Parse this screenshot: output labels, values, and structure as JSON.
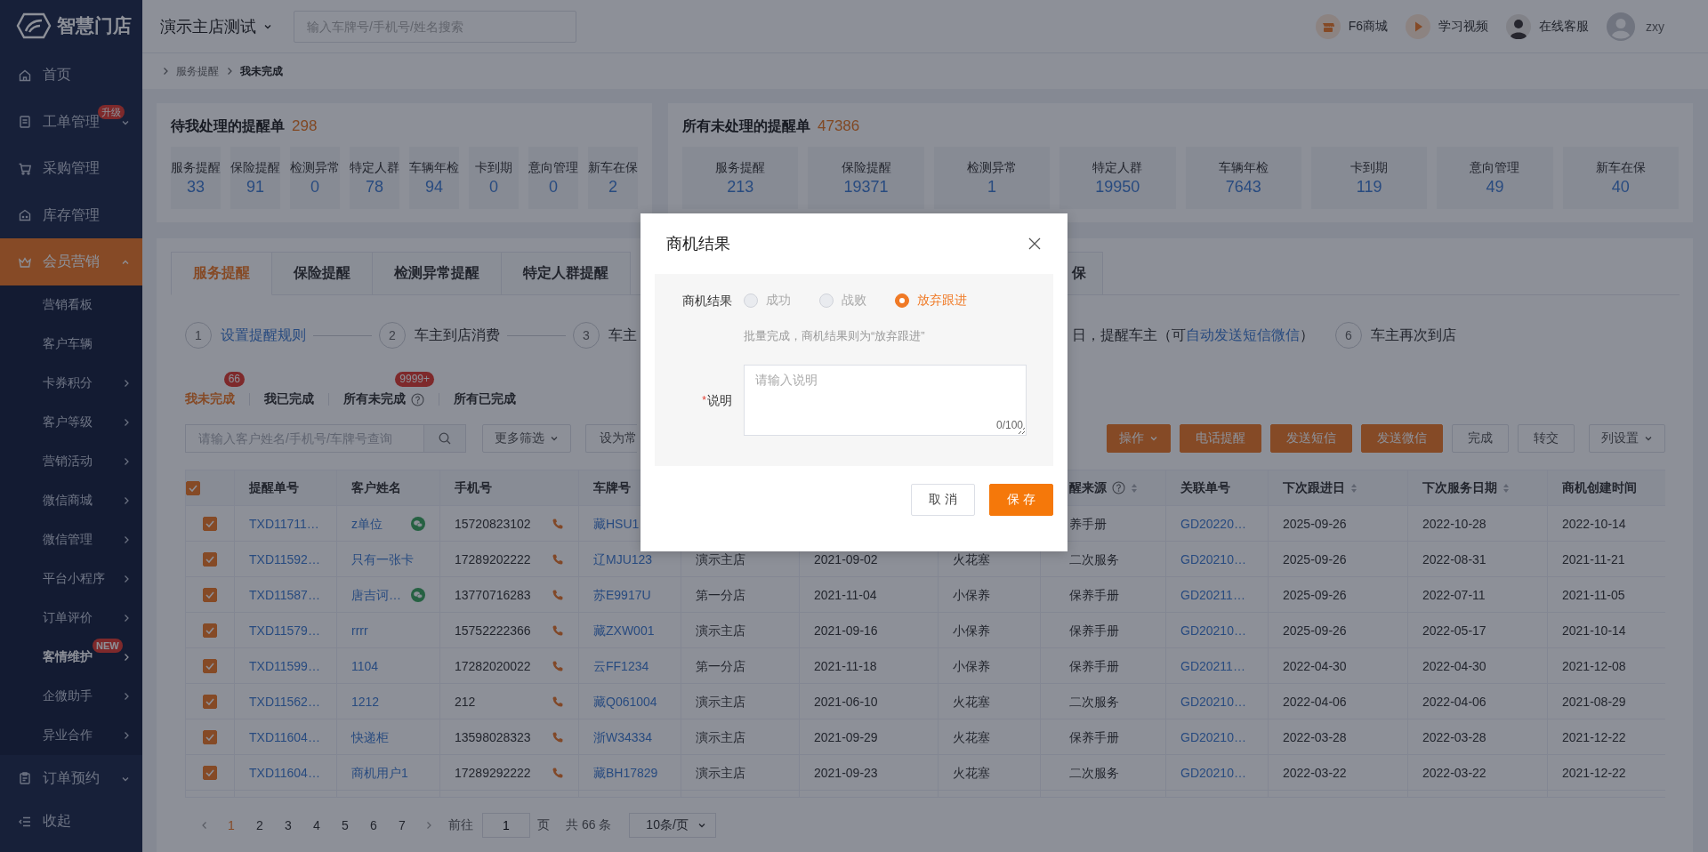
{
  "sidebar": {
    "logo": "智慧门店",
    "items": [
      {
        "kind": "link",
        "label": "首页",
        "selected": false
      },
      {
        "kind": "group",
        "label": "工单管理",
        "badge": "升级",
        "expanded": false,
        "selected": false
      },
      {
        "kind": "link",
        "label": "采购管理",
        "selected": false
      },
      {
        "kind": "link",
        "label": "库存管理",
        "selected": false
      },
      {
        "kind": "group",
        "label": "会员营销",
        "expanded": true,
        "selected": true,
        "children": [
          {
            "kind": "link",
            "label": "营销看板",
            "selected": false
          },
          {
            "kind": "link",
            "label": "客户车辆",
            "selected": false
          },
          {
            "kind": "menu",
            "label": "卡券积分",
            "selected": false
          },
          {
            "kind": "menu",
            "label": "客户等级",
            "selected": false
          },
          {
            "kind": "menu",
            "label": "营销活动",
            "selected": false
          },
          {
            "kind": "menu",
            "label": "微信商城",
            "selected": false
          },
          {
            "kind": "menu",
            "label": "微信管理",
            "selected": false
          },
          {
            "kind": "menu",
            "label": "平台小程序",
            "selected": false
          },
          {
            "kind": "menu",
            "label": "订单评价",
            "selected": false
          },
          {
            "kind": "menu",
            "label": "客情维护",
            "badge": "NEW",
            "selected": true
          },
          {
            "kind": "menu",
            "label": "企微助手",
            "selected": false
          },
          {
            "kind": "menu",
            "label": "异业合作",
            "selected": false
          }
        ]
      },
      {
        "kind": "group",
        "label": "订单预约",
        "expanded": false,
        "selected": false
      }
    ],
    "collapse": "收起"
  },
  "header": {
    "store": "演示主店测试",
    "search_placeholder": "输入车牌号/手机号/姓名搜索",
    "links": [
      {
        "label": "F6商城"
      },
      {
        "label": "学习视频"
      },
      {
        "label": "在线客服"
      }
    ],
    "user": "zxy"
  },
  "breadcrumb": [
    "服务提醒",
    "我未完成"
  ],
  "stats": [
    {
      "title": "待我处理的提醒单",
      "total": "298",
      "tiles": [
        {
          "label": "服务提醒",
          "value": "33"
        },
        {
          "label": "保险提醒",
          "value": "91"
        },
        {
          "label": "检测异常",
          "value": "0"
        },
        {
          "label": "特定人群",
          "value": "78"
        },
        {
          "label": "车辆年检",
          "value": "94"
        },
        {
          "label": "卡到期",
          "value": "0"
        },
        {
          "label": "意向管理",
          "value": "0"
        },
        {
          "label": "新车在保",
          "value": "2"
        }
      ]
    },
    {
      "title": "所有未处理的提醒单",
      "total": "47386",
      "tiles": [
        {
          "label": "服务提醒",
          "value": "213"
        },
        {
          "label": "保险提醒",
          "value": "19371"
        },
        {
          "label": "检测异常",
          "value": "1"
        },
        {
          "label": "特定人群",
          "value": "19950"
        },
        {
          "label": "车辆年检",
          "value": "7643"
        },
        {
          "label": "卡到期",
          "value": "119"
        },
        {
          "label": "意向管理",
          "value": "49"
        },
        {
          "label": "新车在保",
          "value": "40"
        }
      ]
    }
  ],
  "tabs": [
    {
      "label": "服务提醒",
      "selected": true
    },
    {
      "label": "保险提醒",
      "selected": false
    },
    {
      "label": "检测异常提醒",
      "selected": false
    },
    {
      "label": "特定人群提醒",
      "selected": false
    },
    {
      "label": "保",
      "selected": false
    }
  ],
  "steps": [
    {
      "kind": "link",
      "number": "1",
      "label": "设置提醒规则"
    },
    {
      "kind": "plain",
      "number": "2",
      "label": "车主到店消费"
    },
    {
      "kind": "plain",
      "number": "3",
      "label": "车主"
    },
    {
      "kind": "partial",
      "label": "日，提醒车主（可",
      "link": "自动发送短信微信",
      "after": "）"
    },
    {
      "kind": "plain",
      "number": "6",
      "label": "车主再次到店"
    }
  ],
  "filters": [
    {
      "label": "我未完成",
      "selected": true,
      "badge": "66"
    },
    {
      "label": "我已完成",
      "selected": false
    },
    {
      "label": "所有未完成",
      "selected": false,
      "badge": "9999+",
      "help": true
    },
    {
      "label": "所有已完成",
      "selected": false
    }
  ],
  "toolbar": {
    "search_placeholder": "请输入客户姓名/手机号/车牌号查询",
    "filters": [
      {
        "label": "更多筛选",
        "kind": "dropdown"
      },
      {
        "label": "设为常",
        "kind": "cut"
      }
    ],
    "actions": [
      {
        "label": "操作",
        "kind": "primary-dropdown"
      },
      {
        "label": "电话提醒",
        "kind": "primary"
      },
      {
        "label": "发送短信",
        "kind": "primary"
      },
      {
        "label": "发送微信",
        "kind": "primary"
      },
      {
        "label": "完成",
        "kind": "default"
      },
      {
        "label": "转交",
        "kind": "default"
      },
      {
        "label": "列设置",
        "kind": "dropdown"
      }
    ]
  },
  "table": {
    "columns": [
      {
        "kind": "check",
        "checked": true
      },
      {
        "kind": "text",
        "label": "提醒单号"
      },
      {
        "kind": "text",
        "label": "客户姓名"
      },
      {
        "kind": "text",
        "label": "手机号"
      },
      {
        "kind": "text",
        "label": "车牌号"
      },
      {
        "kind": "blank"
      },
      {
        "kind": "blank"
      },
      {
        "kind": "blank"
      },
      {
        "kind": "text",
        "label": "醒来源",
        "help": true,
        "sortable": true
      },
      {
        "kind": "text",
        "label": "关联单号"
      },
      {
        "kind": "text",
        "label": "下次跟进日",
        "sortable": true
      },
      {
        "kind": "text",
        "label": "下次服务日期",
        "sortable": true
      },
      {
        "kind": "text",
        "label": "商机创建时间"
      }
    ],
    "rows": [
      {
        "checked": true,
        "id": "TXD11711…",
        "customer": "z单位",
        "wechat": true,
        "phone": "15720823102",
        "plate": "藏HSU1",
        "source": "养手册",
        "order": "GD20220…",
        "next_follow": "2025-09-26",
        "next_service": "2022-10-28",
        "created": "2022-10-14"
      },
      {
        "checked": true,
        "id": "TXD11592…",
        "customer": "只有一张卡",
        "wechat": false,
        "phone": "17289202222",
        "plate": "辽MJU123",
        "column_6": "演示主店",
        "column_7": "2021-09-02",
        "column_8": "火花塞",
        "source": "二次服务",
        "order": "GD20210…",
        "next_follow": "2025-09-26",
        "next_service": "2022-08-31",
        "created": "2021-11-21"
      },
      {
        "checked": true,
        "id": "TXD11587…",
        "customer": "唐吉诃…",
        "wechat": true,
        "phone": "13770716283",
        "plate": "苏E9917U",
        "column_6": "第一分店",
        "column_7": "2021-11-04",
        "column_8": "小保养",
        "source": "保养手册",
        "order": "GD20211…",
        "next_follow": "2025-09-26",
        "next_service": "2022-07-11",
        "created": "2021-11-05"
      },
      {
        "checked": true,
        "id": "TXD11579…",
        "customer": "rrrr",
        "wechat": false,
        "phone": "15752222366",
        "plate": "藏ZXW001",
        "column_6": "演示主店",
        "column_7": "2021-09-16",
        "column_8": "小保养",
        "source": "保养手册",
        "order": "GD20210…",
        "next_follow": "2025-09-26",
        "next_service": "2022-05-17",
        "created": "2021-10-14"
      },
      {
        "checked": true,
        "id": "TXD11599…",
        "customer": "1104",
        "wechat": false,
        "phone": "17282020022",
        "plate": "云FF1234",
        "column_6": "第一分店",
        "column_7": "2021-11-18",
        "column_8": "小保养",
        "source": "保养手册",
        "order": "GD20211…",
        "next_follow": "2022-04-30",
        "next_service": "2022-04-30",
        "created": "2021-12-08"
      },
      {
        "checked": true,
        "id": "TXD11562…",
        "customer": "1212",
        "wechat": false,
        "phone": "212",
        "plate": "藏Q061004",
        "column_6": "演示主店",
        "column_7": "2021-06-10",
        "column_8": "火花塞",
        "source": "二次服务",
        "order": "GD20210…",
        "next_follow": "2022-04-06",
        "next_service": "2022-04-06",
        "created": "2021-08-29"
      },
      {
        "checked": true,
        "id": "TXD11604…",
        "customer": "快递柜",
        "wechat": false,
        "phone": "13598028323",
        "plate": "浙W34334",
        "column_6": "演示主店",
        "column_7": "2021-09-29",
        "column_8": "火花塞",
        "source": "保养手册",
        "order": "GD20210…",
        "next_follow": "2022-03-28",
        "next_service": "2022-03-28",
        "created": "2021-12-22"
      },
      {
        "checked": true,
        "id": "TXD11604…",
        "customer": "商机用户1",
        "wechat": false,
        "phone": "17289292222",
        "plate": "藏BH17829",
        "column_6": "演示主店",
        "column_7": "2021-09-23",
        "column_8": "火花塞",
        "source": "二次服务",
        "order": "GD20210…",
        "next_follow": "2022-03-22",
        "next_service": "2022-03-22",
        "created": "2021-12-22"
      }
    ]
  },
  "pagination": {
    "pages": [
      {
        "label": "1",
        "selected": true
      },
      {
        "label": "2",
        "selected": false
      },
      {
        "label": "3",
        "selected": false
      },
      {
        "label": "4",
        "selected": false
      },
      {
        "label": "5",
        "selected": false
      },
      {
        "label": "6",
        "selected": false
      },
      {
        "label": "7",
        "selected": false
      }
    ],
    "goto_label": "前往",
    "goto_value": "1",
    "goto_unit": "页",
    "total": "共 66 条",
    "page_size": "10条/页"
  },
  "modal": {
    "title": "商机结果",
    "result_label": "商机结果",
    "options": [
      {
        "label": "成功",
        "selected": false,
        "disabled": true
      },
      {
        "label": "战败",
        "selected": false,
        "disabled": true
      },
      {
        "label": "放弃跟进",
        "selected": true,
        "disabled": false
      }
    ],
    "hint": "批量完成，商机结果则为“放弃跟进”",
    "required_mark": "*",
    "note_label": "说明",
    "note_placeholder": "请输入说明",
    "counter": "0/100",
    "buttons": [
      {
        "label": "取 消",
        "kind": "default"
      },
      {
        "label": "保 存",
        "kind": "primary"
      }
    ]
  }
}
